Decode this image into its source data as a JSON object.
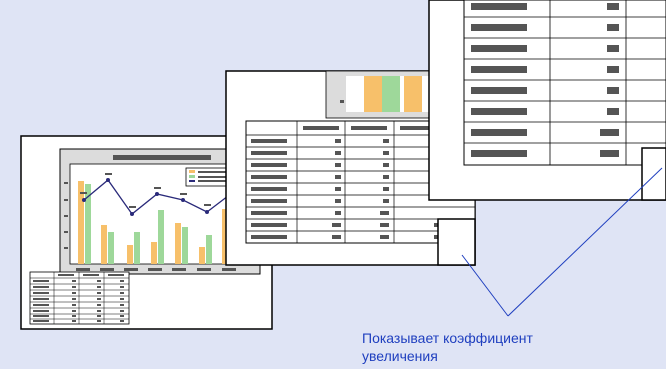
{
  "caption": {
    "line1": "Показывает коэффициент",
    "line2": "увеличения"
  },
  "colors": {
    "background": "#dfe4f5",
    "bar_orange": "#f7c06a",
    "bar_green": "#9ed89a",
    "line_series": "#2a2a7a",
    "placeholder_text": "#555555",
    "callout_line": "#1f3fbf",
    "caption_text": "#1f3fbf"
  },
  "zoom_sequence": [
    "slide-chart-and-table",
    "zoomed-table",
    "further-zoomed-table"
  ]
}
